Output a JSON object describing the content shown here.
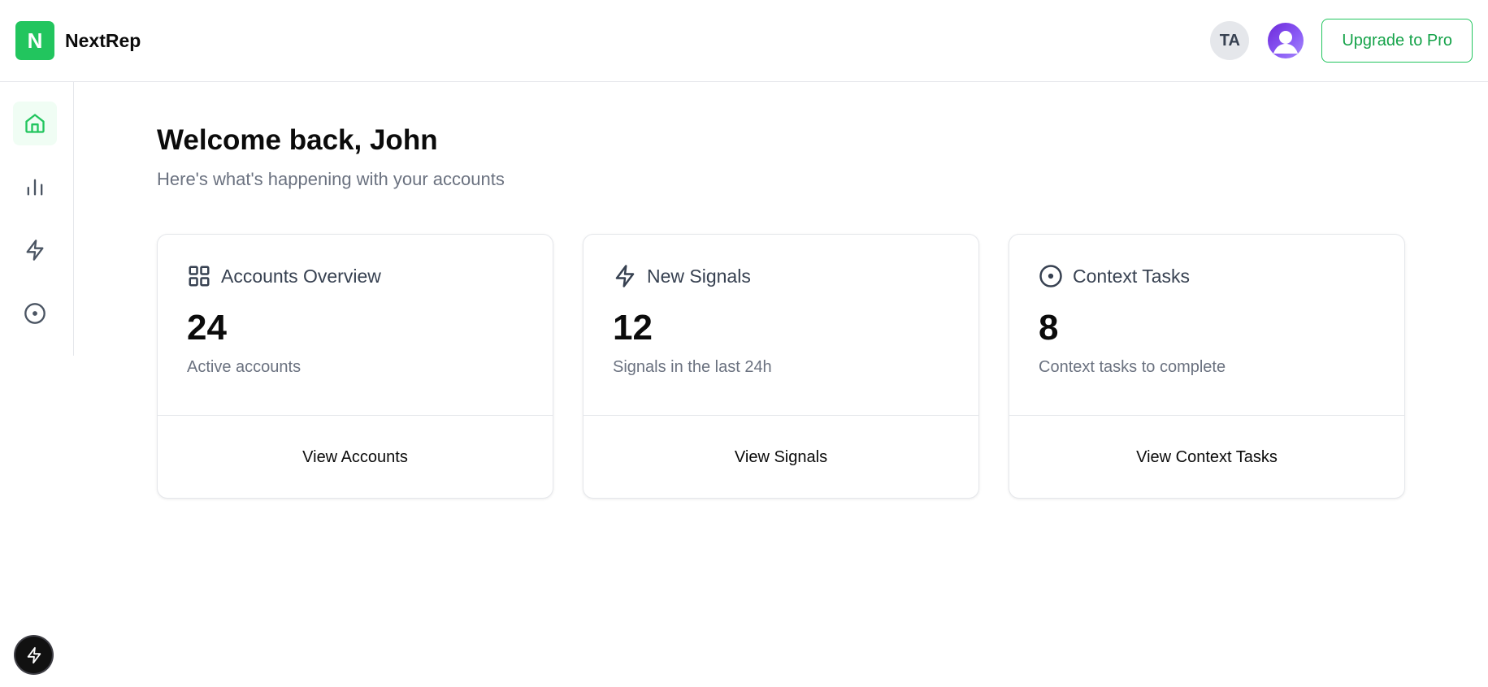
{
  "header": {
    "logo_letter": "N",
    "brand_name": "NextRep",
    "user_initials": "TA",
    "upgrade_label": "Upgrade to Pro"
  },
  "sidebar": {
    "items": [
      {
        "icon": "home-icon",
        "active": true
      },
      {
        "icon": "bar-chart-icon",
        "active": false
      },
      {
        "icon": "lightning-icon",
        "active": false
      },
      {
        "icon": "target-icon",
        "active": false
      }
    ]
  },
  "main": {
    "title": "Welcome back, John",
    "subtitle": "Here's what's happening with your accounts",
    "cards": [
      {
        "icon": "grid-icon",
        "title": "Accounts Overview",
        "value": "24",
        "description": "Active accounts",
        "action": "View Accounts"
      },
      {
        "icon": "lightning-icon",
        "title": "New Signals",
        "value": "12",
        "description": "Signals in the last 24h",
        "action": "View Signals"
      },
      {
        "icon": "target-icon",
        "title": "Context Tasks",
        "value": "8",
        "description": "Context tasks to complete",
        "action": "View Context Tasks"
      }
    ]
  },
  "colors": {
    "accent": "#22c55e",
    "accent_text": "#16a34a",
    "muted_text": "#6b7280",
    "border": "#e5e7eb"
  }
}
